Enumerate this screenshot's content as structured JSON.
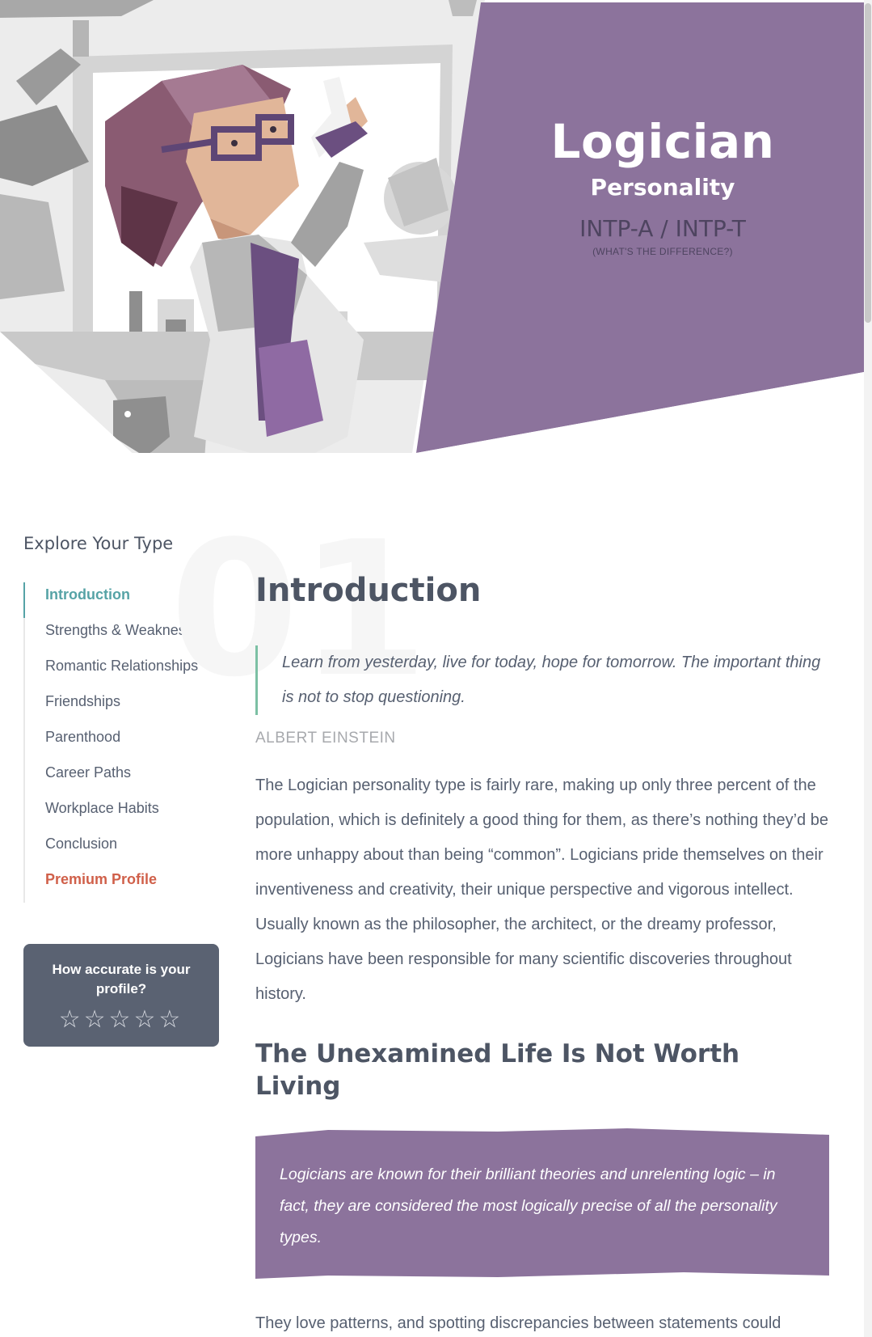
{
  "hero": {
    "title": "Logician",
    "subtitle": "Personality",
    "type_codes": "INTP-A / INTP-T",
    "difference_link": "(WHAT'S THE DIFFERENCE?)",
    "accent_color": "#8c739c"
  },
  "sidebar": {
    "title": "Explore Your Type",
    "items": [
      {
        "label": "Introduction",
        "state": "active"
      },
      {
        "label": "Strengths & Weaknesses"
      },
      {
        "label": "Romantic Relationships"
      },
      {
        "label": "Friendships"
      },
      {
        "label": "Parenthood"
      },
      {
        "label": "Career Paths"
      },
      {
        "label": "Workplace Habits"
      },
      {
        "label": "Conclusion"
      },
      {
        "label": "Premium Profile",
        "state": "premium"
      }
    ],
    "accuracy": {
      "question": "How accurate is your profile?",
      "rating": 0,
      "max": 5
    }
  },
  "main": {
    "section_number": "01",
    "heading": "Introduction",
    "quote": "Learn from yesterday, live for today, hope for tomorrow. The important thing is not to stop questioning.",
    "quote_author": "ALBERT EINSTEIN",
    "paragraph1": "The Logician personality type is fairly rare, making up only three percent of the population, which is definitely a good thing for them, as there’s nothing they’d be more unhappy about than being “common”. Logicians pride themselves on their inventiveness and creativity, their unique perspective and vigorous intellect. Usually known as the philosopher, the architect, or the dreamy professor, Logicians have been responsible for many scientific discoveries throughout history.",
    "heading2": "The Unexamined Life Is Not Worth Living",
    "callout": "Logicians are known for their brilliant theories and unrelenting logic – in fact, they are considered the most logically precise of all the personality types.",
    "paragraph2": "They love patterns, and spotting discrepancies between statements could almost be described as a hobby, making it a bad idea to lie to a Logician. This"
  }
}
